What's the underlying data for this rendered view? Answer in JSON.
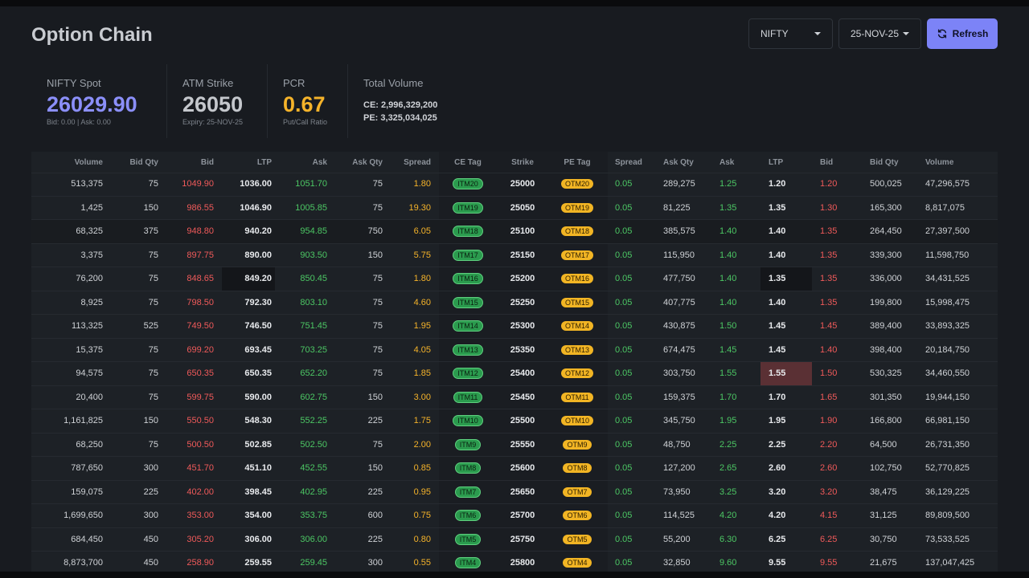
{
  "page": {
    "title": "Option Chain"
  },
  "controls": {
    "symbol": "NIFTY",
    "expiry": "25-NOV-25",
    "refresh_label": "Refresh"
  },
  "stats": {
    "spot": {
      "label": "NIFTY Spot",
      "value": "26029.90",
      "sub": "Bid: 0.00 | Ask: 0.00"
    },
    "atm": {
      "label": "ATM Strike",
      "value": "26050",
      "sub": "Expiry: 25-NOV-25"
    },
    "pcr": {
      "label": "PCR",
      "value": "0.67",
      "sub": "Put/Call Ratio"
    },
    "volume": {
      "label": "Total Volume",
      "ce": "CE: 2,996,329,200",
      "pe": "PE: 3,325,034,025"
    }
  },
  "colors": {
    "accent": "#7c83f7",
    "spot": "#8b8ff9",
    "pcr": "#f5b32a",
    "bid": "#f05a5a",
    "ask": "#4cc764",
    "itm": "#2b9b4e",
    "otm": "#f2b524"
  },
  "table": {
    "columns": [
      "Volume",
      "Bid Qty",
      "Bid",
      "LTP",
      "Ask",
      "Ask Qty",
      "Spread",
      "CE Tag",
      "Strike",
      "PE Tag",
      "Spread",
      "Ask Qty",
      "Ask",
      "LTP",
      "Bid",
      "Bid Qty",
      "Volume"
    ],
    "rows": [
      [
        "513,375",
        "75",
        "1049.90",
        "1036.00",
        "1051.70",
        "75",
        "1.80",
        "ITM20",
        "25000",
        "OTM20",
        "0.05",
        "289,275",
        "1.25",
        "1.20",
        "1.20",
        "500,025",
        "47,296,575"
      ],
      [
        "1,425",
        "150",
        "986.55",
        "1046.90",
        "1005.85",
        "75",
        "19.30",
        "ITM19",
        "25050",
        "OTM19",
        "0.05",
        "81,225",
        "1.35",
        "1.35",
        "1.30",
        "165,300",
        "8,817,075"
      ],
      [
        "68,325",
        "375",
        "948.80",
        "940.20",
        "954.85",
        "750",
        "6.05",
        "ITM18",
        "25100",
        "OTM18",
        "0.05",
        "385,575",
        "1.40",
        "1.40",
        "1.35",
        "264,450",
        "27,397,500"
      ],
      [
        "3,375",
        "75",
        "897.75",
        "890.00",
        "903.50",
        "150",
        "5.75",
        "ITM17",
        "25150",
        "OTM17",
        "0.05",
        "115,950",
        "1.40",
        "1.40",
        "1.35",
        "339,300",
        "11,598,750"
      ],
      [
        "76,200",
        "75",
        "848.65",
        "849.20",
        "850.45",
        "75",
        "1.80",
        "ITM16",
        "25200",
        "OTM16",
        "0.05",
        "477,750",
        "1.40",
        "1.35",
        "1.35",
        "336,000",
        "34,431,525"
      ],
      [
        "8,925",
        "75",
        "798.50",
        "792.30",
        "803.10",
        "75",
        "4.60",
        "ITM15",
        "25250",
        "OTM15",
        "0.05",
        "407,775",
        "1.40",
        "1.40",
        "1.35",
        "199,800",
        "15,998,475"
      ],
      [
        "113,325",
        "525",
        "749.50",
        "746.50",
        "751.45",
        "75",
        "1.95",
        "ITM14",
        "25300",
        "OTM14",
        "0.05",
        "430,875",
        "1.50",
        "1.45",
        "1.45",
        "389,400",
        "33,893,325"
      ],
      [
        "15,375",
        "75",
        "699.20",
        "693.45",
        "703.25",
        "75",
        "4.05",
        "ITM13",
        "25350",
        "OTM13",
        "0.05",
        "674,475",
        "1.45",
        "1.45",
        "1.40",
        "398,400",
        "20,184,750"
      ],
      [
        "94,575",
        "75",
        "650.35",
        "650.35",
        "652.20",
        "75",
        "1.85",
        "ITM12",
        "25400",
        "OTM12",
        "0.05",
        "303,750",
        "1.55",
        "1.55",
        "1.50",
        "530,325",
        "34,460,550"
      ],
      [
        "20,400",
        "75",
        "599.75",
        "590.00",
        "602.75",
        "150",
        "3.00",
        "ITM11",
        "25450",
        "OTM11",
        "0.05",
        "159,375",
        "1.70",
        "1.70",
        "1.65",
        "301,350",
        "19,944,150"
      ],
      [
        "1,161,825",
        "150",
        "550.50",
        "548.30",
        "552.25",
        "225",
        "1.75",
        "ITM10",
        "25500",
        "OTM10",
        "0.05",
        "345,750",
        "1.95",
        "1.95",
        "1.90",
        "166,800",
        "66,981,150"
      ],
      [
        "68,250",
        "75",
        "500.50",
        "502.85",
        "502.50",
        "75",
        "2.00",
        "ITM9",
        "25550",
        "OTM9",
        "0.05",
        "48,750",
        "2.25",
        "2.25",
        "2.20",
        "64,500",
        "26,731,350"
      ],
      [
        "787,650",
        "300",
        "451.70",
        "451.10",
        "452.55",
        "150",
        "0.85",
        "ITM8",
        "25600",
        "OTM8",
        "0.05",
        "127,200",
        "2.65",
        "2.60",
        "2.60",
        "102,750",
        "52,770,825"
      ],
      [
        "159,075",
        "225",
        "402.00",
        "398.45",
        "402.95",
        "225",
        "0.95",
        "ITM7",
        "25650",
        "OTM7",
        "0.05",
        "73,950",
        "3.25",
        "3.20",
        "3.20",
        "38,475",
        "36,129,225"
      ],
      [
        "1,699,650",
        "300",
        "353.00",
        "354.00",
        "353.75",
        "600",
        "0.75",
        "ITM6",
        "25700",
        "OTM6",
        "0.05",
        "114,525",
        "4.20",
        "4.20",
        "4.15",
        "31,125",
        "89,809,500"
      ],
      [
        "684,450",
        "450",
        "305.20",
        "306.00",
        "306.00",
        "225",
        "0.80",
        "ITM5",
        "25750",
        "OTM5",
        "0.05",
        "55,200",
        "6.30",
        "6.25",
        "6.25",
        "30,750",
        "73,533,525"
      ],
      [
        "8,873,700",
        "450",
        "258.90",
        "259.55",
        "259.45",
        "300",
        "0.55",
        "ITM4",
        "25800",
        "OTM4",
        "0.05",
        "32,850",
        "9.60",
        "9.55",
        "9.55",
        "21,675",
        "137,047,425"
      ]
    ]
  }
}
